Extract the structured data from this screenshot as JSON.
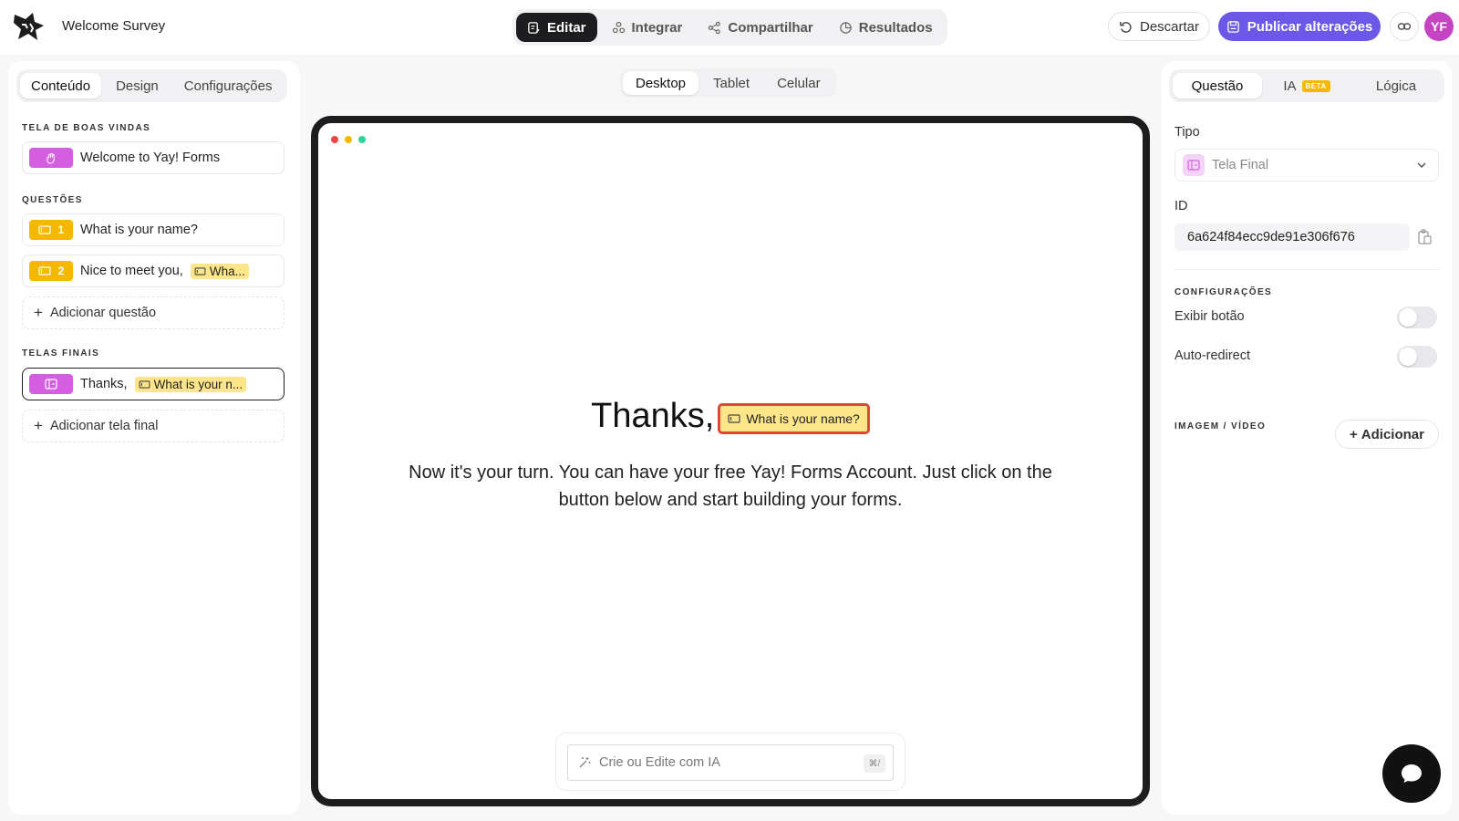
{
  "header": {
    "form_title": "Welcome Survey",
    "modes": [
      {
        "label": "Editar",
        "active": true
      },
      {
        "label": "Integrar",
        "active": false
      },
      {
        "label": "Compartilhar",
        "active": false
      },
      {
        "label": "Resultados",
        "active": false
      }
    ],
    "discard_label": "Descartar",
    "publish_label": "Publicar alterações",
    "avatar_initials": "YF"
  },
  "left_panel": {
    "tabs": [
      {
        "label": "Conteúdo",
        "active": true
      },
      {
        "label": "Design",
        "active": false
      },
      {
        "label": "Configurações",
        "active": false
      }
    ],
    "welcome_heading": "TELA DE BOAS VINDAS",
    "welcome_item": "Welcome to Yay! Forms",
    "questions_heading": "QUESTÕES",
    "questions": [
      {
        "number": "1",
        "label": "What is your name?",
        "chip": ""
      },
      {
        "number": "2",
        "label": "Nice to meet you,",
        "chip": "Wha..."
      }
    ],
    "add_question_label": "Adicionar questão",
    "endings_heading": "TELAS FINAIS",
    "ending_item": {
      "label": "Thanks,",
      "chip": "What is your n..."
    },
    "add_ending_label": "Adicionar tela final"
  },
  "preview": {
    "device_tabs": [
      {
        "label": "Desktop",
        "active": true
      },
      {
        "label": "Tablet",
        "active": false
      },
      {
        "label": "Celular",
        "active": false
      }
    ],
    "title": "Thanks,",
    "title_chip": "What is your name?",
    "body": "Now it's your turn. You can have your free Yay! Forms Account. Just click on the button below and start building your forms.",
    "ai_placeholder": "Crie ou Edite com IA",
    "ai_shortcut": "⌘/"
  },
  "right_panel": {
    "tabs": [
      {
        "label": "Questão",
        "active": true
      },
      {
        "label": "IA",
        "badge": "BETA",
        "active": false
      },
      {
        "label": "Lógica",
        "active": false
      }
    ],
    "type_label": "Tipo",
    "type_value": "Tela Final",
    "id_label": "ID",
    "id_value": "6a624f84ecc9de91e306f676",
    "settings_heading": "CONFIGURAÇÕES",
    "show_button_label": "Exibir botão",
    "show_button_on": false,
    "auto_redirect_label": "Auto-redirect",
    "auto_redirect_on": false,
    "media_heading": "IMAGEM / VÍDEO",
    "add_media_label": "Adicionar"
  },
  "colors": {
    "accent": "#6b58e6",
    "welcome_tag": "#d35fe0",
    "question_tag": "#f5b800",
    "chip_bg": "#fde68a",
    "chip_highlight_border": "#e04634"
  }
}
